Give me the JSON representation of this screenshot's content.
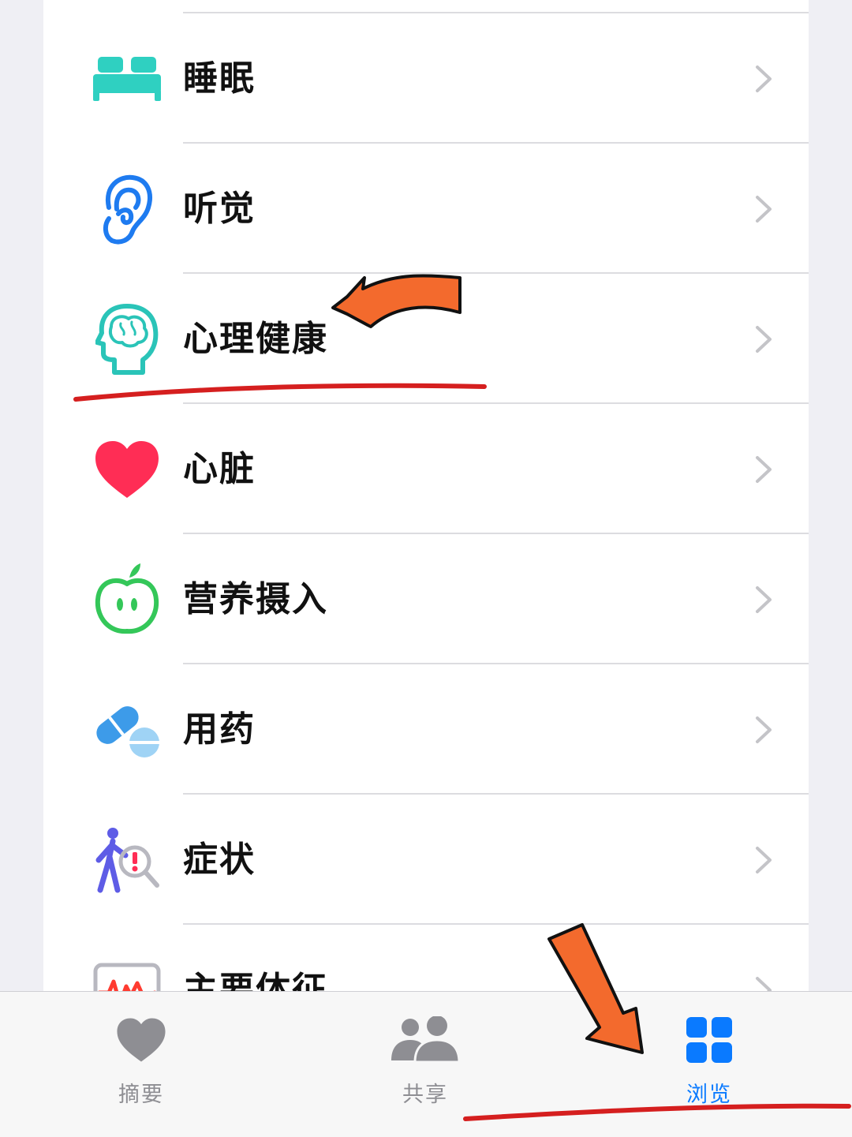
{
  "browse_list": {
    "items": [
      {
        "label": "睡眠",
        "icon": "bed-icon"
      },
      {
        "label": "听觉",
        "icon": "ear-icon"
      },
      {
        "label": "心理健康",
        "icon": "brain-head-icon"
      },
      {
        "label": "心脏",
        "icon": "heart-icon"
      },
      {
        "label": "营养摄入",
        "icon": "apple-icon"
      },
      {
        "label": "用药",
        "icon": "pills-icon"
      },
      {
        "label": "症状",
        "icon": "person-alert-icon"
      },
      {
        "label": "主要体征",
        "icon": "vitals-monitor-icon"
      }
    ]
  },
  "tab_bar": {
    "tabs": [
      {
        "label": "摘要",
        "icon": "heart-icon",
        "active": false
      },
      {
        "label": "共享",
        "icon": "people-icon",
        "active": false
      },
      {
        "label": "浏览",
        "icon": "grid-icon",
        "active": true
      }
    ]
  },
  "colors": {
    "sleep": "#2fd0c1",
    "hearing": "#1e7bf0",
    "mental": "#2ac4b8",
    "heart": "#ff2d55",
    "nutrition": "#34c759",
    "medication": "#3d9be9",
    "symptoms": "#5e5ce6",
    "vitals": "#ff3b30",
    "tab_active": "#0a7aff",
    "tab_inactive": "#8e8e93",
    "annotation_arrow": "#f36a2d",
    "annotation_underline": "#d51f1f"
  }
}
